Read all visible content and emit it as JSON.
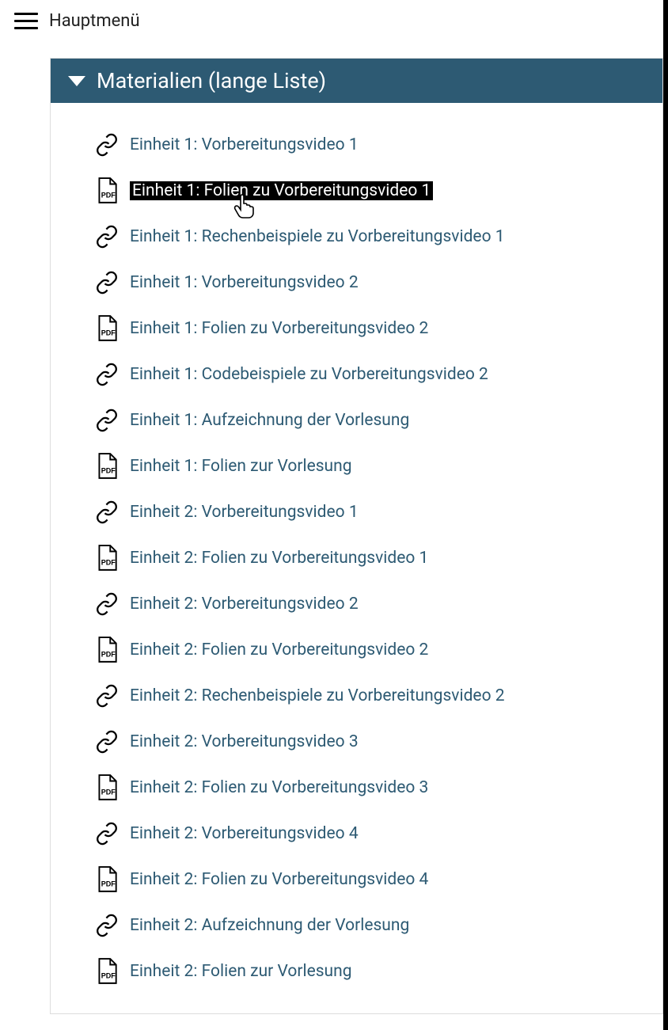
{
  "topbar": {
    "title": "Hauptmenü"
  },
  "panel": {
    "title": "Materialien (lange Liste)"
  },
  "items": [
    {
      "icon": "link",
      "label": "Einheit 1: Vorbereitungsvideo 1",
      "selected": false
    },
    {
      "icon": "pdf",
      "label": "Einheit 1: Folien zu Vorbereitungsvideo 1",
      "selected": true
    },
    {
      "icon": "link",
      "label": "Einheit 1: Rechenbeispiele zu Vorbereitungsvideo 1",
      "selected": false
    },
    {
      "icon": "link",
      "label": "Einheit 1: Vorbereitungsvideo 2",
      "selected": false
    },
    {
      "icon": "pdf",
      "label": "Einheit 1: Folien zu Vorbereitungsvideo 2",
      "selected": false
    },
    {
      "icon": "link",
      "label": "Einheit 1: Codebeispiele zu Vorbereitungsvideo 2",
      "selected": false
    },
    {
      "icon": "link",
      "label": "Einheit 1: Aufzeichnung der Vorlesung",
      "selected": false
    },
    {
      "icon": "pdf",
      "label": "Einheit 1: Folien zur Vorlesung",
      "selected": false
    },
    {
      "icon": "link",
      "label": "Einheit 2: Vorbereitungsvideo 1",
      "selected": false
    },
    {
      "icon": "pdf",
      "label": "Einheit 2: Folien zu Vorbereitungsvideo 1",
      "selected": false
    },
    {
      "icon": "link",
      "label": "Einheit 2: Vorbereitungsvideo 2",
      "selected": false
    },
    {
      "icon": "pdf",
      "label": "Einheit 2: Folien zu Vorbereitungsvideo 2",
      "selected": false
    },
    {
      "icon": "link",
      "label": "Einheit 2: Rechenbeispiele zu Vorbereitungsvideo 2",
      "selected": false
    },
    {
      "icon": "link",
      "label": "Einheit 2: Vorbereitungsvideo 3",
      "selected": false
    },
    {
      "icon": "pdf",
      "label": "Einheit 2: Folien zu Vorbereitungsvideo 3",
      "selected": false
    },
    {
      "icon": "link",
      "label": "Einheit 2: Vorbereitungsvideo 4",
      "selected": false
    },
    {
      "icon": "pdf",
      "label": "Einheit 2: Folien zu Vorbereitungsvideo 4",
      "selected": false
    },
    {
      "icon": "link",
      "label": "Einheit 2: Aufzeichnung der Vorlesung",
      "selected": false
    },
    {
      "icon": "pdf",
      "label": "Einheit 2: Folien zur Vorlesung",
      "selected": false
    }
  ]
}
